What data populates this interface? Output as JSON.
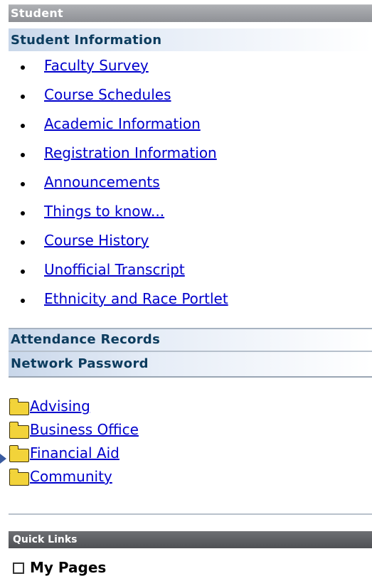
{
  "student_header": {
    "title": "Student"
  },
  "student_information": {
    "title": "Student Information",
    "links": [
      "Faculty Survey",
      "Course Schedules",
      "Academic Information",
      "Registration Information",
      "Announcements",
      "Things to know...",
      "Course History",
      "Unofficial Transcript",
      "Ethnicity and Race Portlet"
    ]
  },
  "attendance_records": {
    "title": "Attendance Records"
  },
  "network_password": {
    "title": "Network Password"
  },
  "folders": [
    "Advising",
    "Business Office",
    "Financial Aid",
    "Community"
  ],
  "quick_links": {
    "title": "Quick Links"
  },
  "my_pages": {
    "label": "My Pages"
  },
  "icons": {
    "bullet": "bullet-icon",
    "folder": "folder-icon",
    "pointer": "arrow-right-icon",
    "checkbox": "checkbox-icon"
  },
  "colors": {
    "link": "#0000cc",
    "section_title": "#0c3c5e",
    "student_header_bg": "#9a9ca0",
    "quick_links_bg": "#5e6064",
    "folder": "#f2d33a"
  }
}
